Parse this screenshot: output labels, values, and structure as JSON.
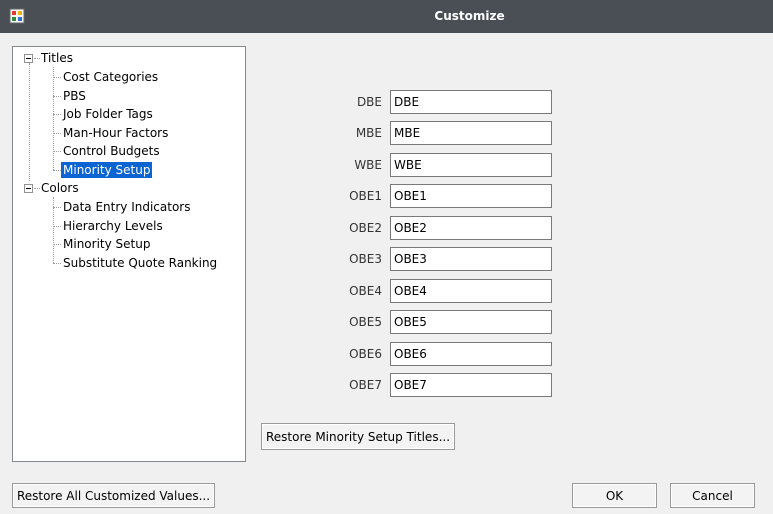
{
  "window": {
    "title": "Customize"
  },
  "tree": {
    "groups": [
      {
        "label": "Titles",
        "items": [
          "Cost Categories",
          "PBS",
          "Job Folder Tags",
          "Man-Hour Factors",
          "Control Budgets",
          "Minority Setup"
        ],
        "selected_item": "Minority Setup"
      },
      {
        "label": "Colors",
        "items": [
          "Data Entry Indicators",
          "Hierarchy Levels",
          "Minority Setup",
          "Substitute Quote Ranking"
        ]
      }
    ]
  },
  "fields": [
    {
      "label": "DBE",
      "value": "DBE"
    },
    {
      "label": "MBE",
      "value": "MBE"
    },
    {
      "label": "WBE",
      "value": "WBE"
    },
    {
      "label": "OBE1",
      "value": "OBE1"
    },
    {
      "label": "OBE2",
      "value": "OBE2"
    },
    {
      "label": "OBE3",
      "value": "OBE3"
    },
    {
      "label": "OBE4",
      "value": "OBE4"
    },
    {
      "label": "OBE5",
      "value": "OBE5"
    },
    {
      "label": "OBE6",
      "value": "OBE6"
    },
    {
      "label": "OBE7",
      "value": "OBE7"
    }
  ],
  "buttons": {
    "restore_section": "Restore Minority Setup Titles...",
    "restore_all": "Restore All Customized Values...",
    "ok": "OK",
    "cancel": "Cancel"
  },
  "colors": {
    "titlebar": "#4a4f55",
    "selection": "#0a64d2"
  }
}
